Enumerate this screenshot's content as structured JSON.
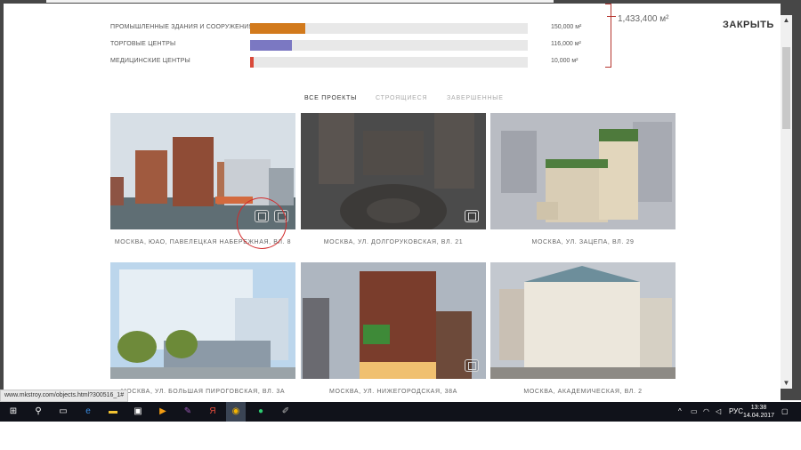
{
  "page": {
    "total_area": "1,433,400 м²",
    "close_label": "ЗАКРЫТЬ",
    "stats": [
      {
        "label": "ПРОМЫШЛЕННЫЕ ЗДАНИЯ И СООРУЖЕНИЯ",
        "value": "150,000 м²",
        "fill_fraction": 0.2,
        "color": "#d27a1c"
      },
      {
        "label": "ТОРГОВЫЕ ЦЕНТРЫ",
        "value": "116,000 м²",
        "fill_fraction": 0.15,
        "color": "#7b78c2"
      },
      {
        "label": "МЕДИЦИНСКИЕ ЦЕНТРЫ",
        "value": "10,000 м²",
        "fill_fraction": 0.012,
        "color": "#d94a3a"
      }
    ],
    "tabs": [
      "ВСЕ ПРОЕКТЫ",
      "СТРОЯЩИЕСЯ",
      "ЗАВЕРШЕННЫЕ"
    ],
    "projects": [
      {
        "caption": "МОСКВА, ЮАО, ПАВЕЛЕЦКАЯ НАБЕРЕЖНАЯ, ВЛ. 8"
      },
      {
        "caption": "МОСКВА, УЛ. ДОЛГОРУКОВСКАЯ, ВЛ. 21"
      },
      {
        "caption": "МОСКВА, УЛ. ЗАЦЕПА, ВЛ. 29"
      },
      {
        "caption": "МОСКВА, УЛ. БОЛЬШАЯ ПИРОГОВСКАЯ, ВЛ. 3А"
      },
      {
        "caption": "МОСКВА, УЛ. НИЖЕГОРОДСКАЯ, 38А"
      },
      {
        "caption": "МОСКВА, АКАДЕМИЧЕСКАЯ, ВЛ. 2"
      }
    ]
  },
  "status_url": "www.mkstroy.com/objects.html?300516_1#",
  "taskbar": {
    "language": "РУС",
    "time": "13:38",
    "date": "14.04.2017",
    "icons": [
      "windows-start-icon",
      "search-icon",
      "task-view-icon",
      "edge-icon",
      "file-explorer-icon",
      "store-icon",
      "media-player-icon",
      "paint-icon",
      "yandex-icon",
      "chrome-icon",
      "green-app-icon",
      "notes-icon"
    ]
  }
}
